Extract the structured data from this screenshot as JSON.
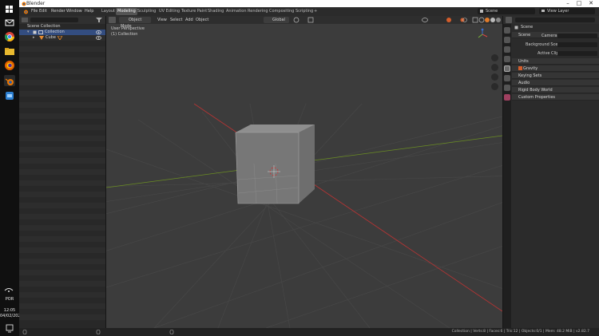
{
  "window": {
    "title": "Blender"
  },
  "taskbar": {
    "time": "12:05",
    "date": "04/02/2020",
    "language": "POR"
  },
  "topbar": {
    "menus": [
      "File",
      "Edit",
      "Render",
      "Window",
      "Help"
    ],
    "workspaces": [
      "Layout",
      "Modeling",
      "Sculpting",
      "UV Editing",
      "Texture Paint",
      "Shading",
      "Animation",
      "Rendering",
      "Compositing",
      "Scripting"
    ],
    "active_workspace": "Modeling",
    "add_tab": "+",
    "scene": "Scene",
    "view_layer": "View Layer"
  },
  "outliner": {
    "rows": [
      {
        "label": "Scene Collection",
        "selected": false
      },
      {
        "label": "Collection",
        "selected": true
      },
      {
        "label": "Cube",
        "selected": false
      }
    ]
  },
  "viewport": {
    "mode": "Object Mode",
    "menus": [
      "View",
      "Select",
      "Add",
      "Object"
    ],
    "transform": "Global",
    "overlay_title": "User Perspective",
    "overlay_sub": "(1) Collection"
  },
  "properties": {
    "panel_title": "Scene",
    "header_scene": "Scene",
    "fields": [
      {
        "label": "Camera"
      },
      {
        "label": "Background Scene"
      },
      {
        "label": "Active Clip"
      }
    ],
    "sections": [
      "Units",
      "Gravity",
      "Keying Sets",
      "Audio",
      "Rigid Body World",
      "Custom Properties"
    ],
    "gravity_checked": true
  },
  "statusbar": {
    "text": "Collection | Verts:8 | Faces:6 | Tris:12 | Objects:0/1 | Mem: 48.2 MiB | v2.82.7"
  },
  "colors": {
    "accent_blue": "#334d80",
    "x_axis": "#b33434",
    "y_axis": "#6b8e23",
    "active_tab": "#545454"
  }
}
